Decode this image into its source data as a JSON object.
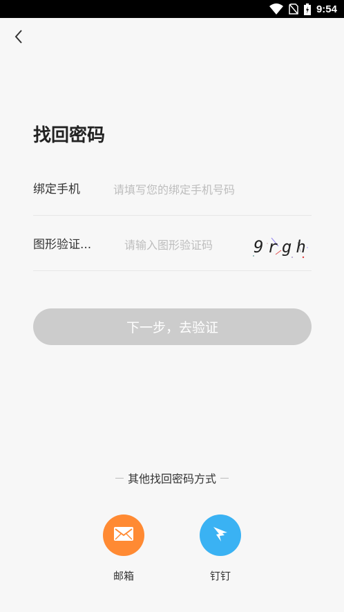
{
  "status_bar": {
    "time": "9:54"
  },
  "title": "找回密码",
  "form": {
    "phone": {
      "label": "绑定手机",
      "placeholder": "请填写您的绑定手机号码"
    },
    "captcha": {
      "label": "图形验证...",
      "placeholder": "请输入图形验证码",
      "code": "9rgh"
    }
  },
  "next_button": "下一步，去验证",
  "other_methods": {
    "title": "其他找回密码方式",
    "email": "邮箱",
    "dingtalk": "钉钉"
  },
  "colors": {
    "email": "#ff8a33",
    "dingtalk": "#3ab2f3",
    "button_disabled": "#cccccc"
  },
  "icons": [
    "wifi-icon",
    "no-sim-icon",
    "battery-icon",
    "back-arrow-icon",
    "envelope-icon",
    "dingtalk-icon"
  ]
}
